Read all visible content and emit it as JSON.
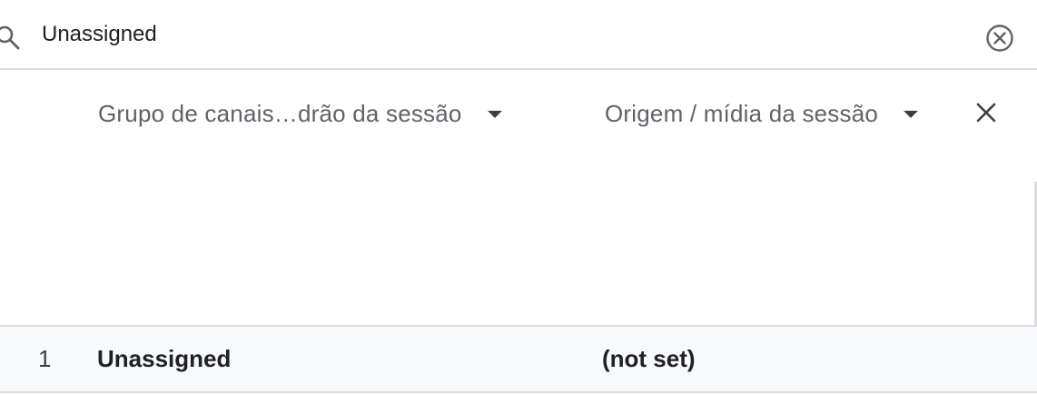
{
  "search": {
    "value": "Unassigned",
    "icon": "search-icon",
    "clear_icon": "clear-circle-icon"
  },
  "dimensions": {
    "primary": {
      "label": "Grupo de canais…drão da sessão",
      "icon": "chevron-down-icon"
    },
    "secondary": {
      "label": "Origem / mídia da sessão",
      "icon": "chevron-down-icon"
    },
    "remove_icon": "close-icon"
  },
  "rows": [
    {
      "index": "1",
      "group": "Unassigned",
      "source": "(not set)"
    }
  ]
}
